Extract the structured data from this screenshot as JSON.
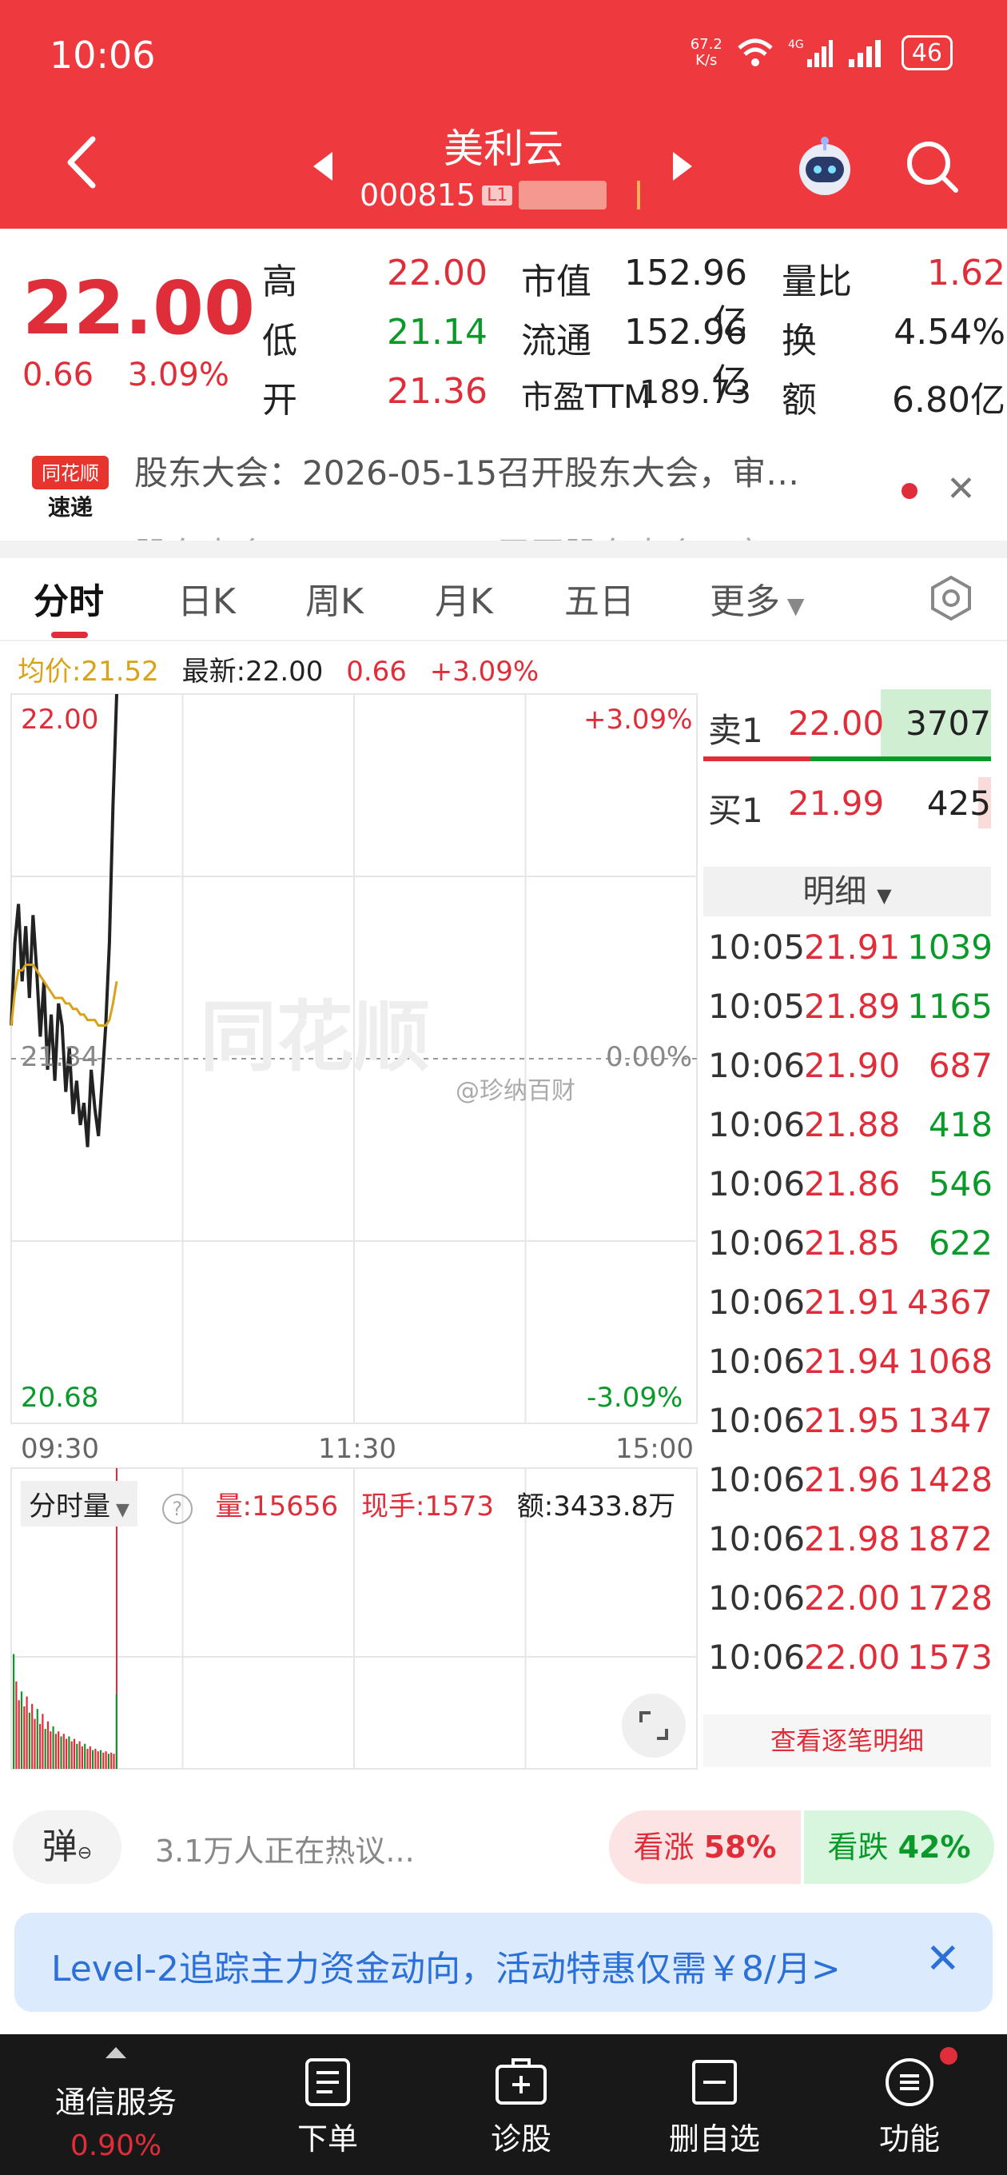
{
  "status": {
    "time": "10:06",
    "netspeed_value": "67.2",
    "netspeed_unit": "K/s",
    "battery": "46"
  },
  "header": {
    "stock_name": "美利云",
    "stock_code": "000815",
    "level_badge": "L1"
  },
  "quote": {
    "price": "22.00",
    "change": "0.66",
    "change_pct": "3.09%",
    "high_label": "高",
    "high": "22.00",
    "low_label": "低",
    "low": "21.14",
    "open_label": "开",
    "open": "21.36",
    "mktcap_label": "市值",
    "mktcap": "152.96亿",
    "float_label": "流通",
    "float": "152.96亿",
    "pe_label": "市盈TTM",
    "pe": "189.73",
    "vol_ratio_label": "量比",
    "vol_ratio": "1.62",
    "turnover_label": "换",
    "turnover": "4.54%",
    "amount_label": "额",
    "amount": "6.80亿"
  },
  "news": {
    "logo_line1": "同花顺",
    "logo_line2": "速递",
    "text": "股东大会：2026-05-15召开股东大会，审…",
    "text_next": "股东大会：2026-05-15召开股东大会，审…"
  },
  "tabs": [
    "分时",
    "日K",
    "周K",
    "月K",
    "五日",
    "更多"
  ],
  "chart_info": {
    "avg_label": "均价:21.52",
    "latest_label": "最新:22.00",
    "change": "0.66",
    "change_pct": "+3.09%"
  },
  "chart_data": {
    "type": "line",
    "x_ticks": [
      "09:30",
      "11:30",
      "15:00"
    ],
    "y_left_ticks": [
      "22.00",
      "21.34",
      "20.68"
    ],
    "y_right_ticks": [
      "+3.09%",
      "0.00%",
      "-3.09%"
    ],
    "ylim": [
      20.68,
      22.0
    ],
    "watermark": "同花顺",
    "credit": "@珍纳百财",
    "series": [
      {
        "values": [
          21.4,
          21.55,
          21.62,
          21.48,
          21.58,
          21.45,
          21.6,
          21.5,
          21.38,
          21.48,
          21.32,
          21.42,
          21.3,
          21.44,
          21.4,
          21.28,
          21.36,
          21.24,
          21.3,
          21.22,
          21.26,
          21.18,
          21.32,
          21.25,
          21.2,
          21.3,
          21.4,
          21.55,
          21.8,
          22.0
        ]
      },
      {
        "values": [
          21.4,
          21.46,
          21.5,
          21.5,
          21.51,
          21.51,
          21.51,
          21.5,
          21.49,
          21.48,
          21.47,
          21.46,
          21.45,
          21.45,
          21.45,
          21.44,
          21.44,
          21.43,
          21.43,
          21.42,
          21.42,
          21.41,
          21.41,
          21.41,
          21.4,
          21.4,
          21.4,
          21.41,
          21.44,
          21.48
        ]
      }
    ]
  },
  "orderbook": {
    "ask1_label": "卖1",
    "ask1_price": "22.00",
    "ask1_vol": "3707",
    "bid1_label": "买1",
    "bid1_price": "21.99",
    "bid1_vol": "425",
    "detail_label": "明细"
  },
  "ticks": [
    {
      "time": "10:05",
      "price": "21.91",
      "vol": "1039",
      "dir": "green"
    },
    {
      "time": "10:05",
      "price": "21.89",
      "vol": "1165",
      "dir": "green"
    },
    {
      "time": "10:06",
      "price": "21.90",
      "vol": "687",
      "dir": "red"
    },
    {
      "time": "10:06",
      "price": "21.88",
      "vol": "418",
      "dir": "green"
    },
    {
      "time": "10:06",
      "price": "21.86",
      "vol": "546",
      "dir": "green"
    },
    {
      "time": "10:06",
      "price": "21.85",
      "vol": "622",
      "dir": "green"
    },
    {
      "time": "10:06",
      "price": "21.91",
      "vol": "4367",
      "dir": "red"
    },
    {
      "time": "10:06",
      "price": "21.94",
      "vol": "1068",
      "dir": "red"
    },
    {
      "time": "10:06",
      "price": "21.95",
      "vol": "1347",
      "dir": "red"
    },
    {
      "time": "10:06",
      "price": "21.96",
      "vol": "1428",
      "dir": "red"
    },
    {
      "time": "10:06",
      "price": "21.98",
      "vol": "1872",
      "dir": "red"
    },
    {
      "time": "10:06",
      "price": "22.00",
      "vol": "1728",
      "dir": "red"
    },
    {
      "time": "10:06",
      "price": "22.00",
      "vol": "1573",
      "dir": "red"
    }
  ],
  "view_ticks": "查看逐笔明细",
  "volume": {
    "dropdown": "分时量",
    "vol": "量:15656",
    "cur": "现手:1573",
    "amount": "额:3433.8万"
  },
  "discussion": {
    "danmu": "弹",
    "text": "3.1万人正在热议...",
    "bull_label": "看涨",
    "bull_pct": "58%",
    "bear_label": "看跌",
    "bear_pct": "42%"
  },
  "promo": {
    "text": "Level-2追踪主力资金动向，活动特惠仅需￥8/月>"
  },
  "bottom_nav": {
    "ticker_name": "通信服务",
    "ticker_change": "0.90%",
    "items": [
      "下单",
      "诊股",
      "删自选",
      "功能"
    ]
  }
}
